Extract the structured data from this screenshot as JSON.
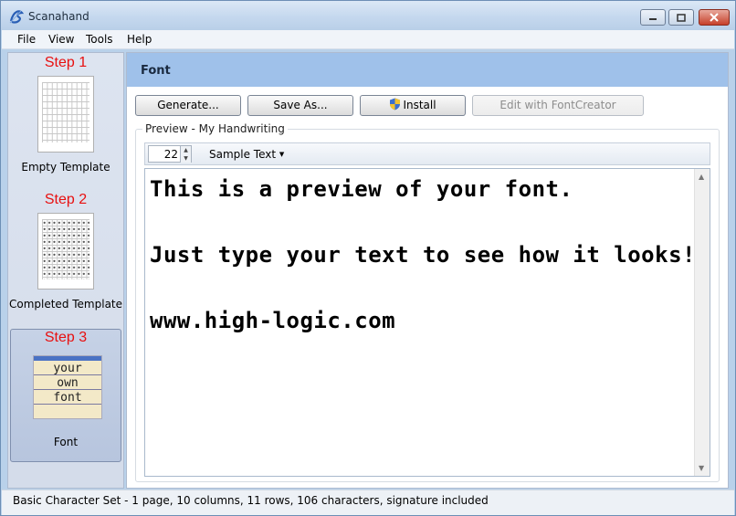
{
  "window": {
    "title": "Scanahand"
  },
  "menu": {
    "items": [
      "File",
      "View",
      "Tools",
      "Help"
    ]
  },
  "sidebar": {
    "steps": [
      {
        "title": "Step 1",
        "label": "Empty Template"
      },
      {
        "title": "Step 2",
        "label": "Completed Template"
      },
      {
        "title": "Step 3",
        "label": "Font",
        "preview_words": [
          "your",
          "own",
          "font"
        ]
      }
    ],
    "selected_step": 3
  },
  "main": {
    "section_title": "Font",
    "buttons": {
      "generate": "Generate...",
      "save_as": "Save As...",
      "install": "Install",
      "edit_with_fontcreator": "Edit with FontCreator"
    },
    "preview_group_label": "Preview - My Handwriting",
    "font_size": "22",
    "sample_text_label": "Sample Text",
    "preview_lines": [
      "This is a preview of your font.",
      "Just type your text to see how it looks!",
      "www.high-logic.com"
    ]
  },
  "status": {
    "text": "Basic Character Set - 1 page, 10 columns, 11 rows, 106 characters, signature included"
  },
  "colors": {
    "step_title": "#e81010",
    "section_header": "#9fc1ea",
    "selection": "#b7c5de"
  }
}
